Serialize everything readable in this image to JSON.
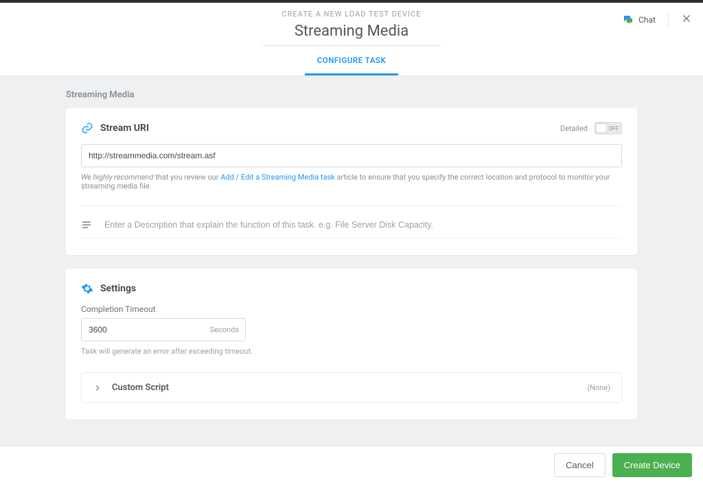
{
  "header": {
    "breadcrumb": "CREATE A NEW LOAD TEST DEVICE",
    "title": "Streaming Media",
    "tab": "CONFIGURE TASK",
    "chat_label": "Chat"
  },
  "section_label": "Streaming Media",
  "stream": {
    "title": "Stream URI",
    "detailed_label": "Detailed",
    "toggle_state": "OFF",
    "uri_value": "http://streammedia.com/stream.asf",
    "help_pre": "We highly recommend",
    "help_mid": " that you review our ",
    "help_link": "Add / Edit a Streaming Media task",
    "help_post": " article to ensure that you specify the correct location and protocol to monitor your streaming media file.",
    "description_placeholder": "Enter a Description that explain the function of this task. e.g. File Server Disk Capacity."
  },
  "settings": {
    "title": "Settings",
    "timeout_label": "Completion Timeout",
    "timeout_value": "3600",
    "timeout_suffix": "Seconds",
    "timeout_hint": "Task will generate an error after exceeding timeout.",
    "custom_script_label": "Custom Script",
    "custom_script_status": "(None)"
  },
  "footer": {
    "cancel": "Cancel",
    "create": "Create Device"
  }
}
